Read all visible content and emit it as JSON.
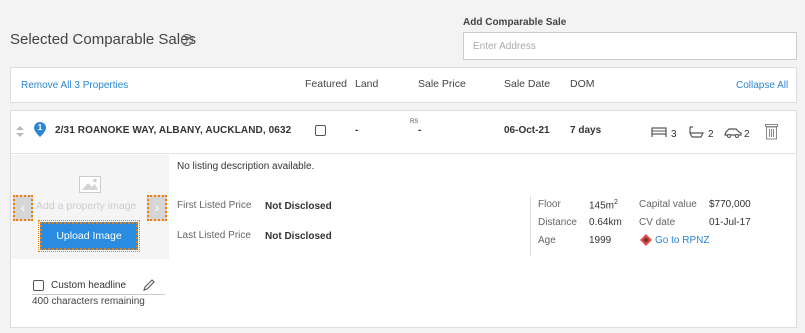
{
  "page": {
    "title": "Selected Comparable Sales",
    "help_icon": "?"
  },
  "add_sale": {
    "label": "Add Comparable Sale",
    "placeholder": "Enter Address"
  },
  "header": {
    "remove_all": "Remove All 3 Properties",
    "columns": {
      "featured": "Featured",
      "land": "Land",
      "sale_price": "Sale Price",
      "sale_date": "Sale Date",
      "dom": "DOM"
    },
    "collapse_all": "Collapse All"
  },
  "property": {
    "pin_number": "1",
    "address": "2/31 ROANOKE WAY, ALBANY, AUCKLAND, 0632",
    "land": "-",
    "sale_price_tag": "RS",
    "sale_price": "-",
    "sale_date": "06-Oct-21",
    "dom": "7 days",
    "bedrooms": "3",
    "bathrooms": "2",
    "car_parks": "2",
    "description": "No listing description available.",
    "add_image_text": "Add a property image",
    "upload_button": "Upload Image",
    "prev_arrow": "‹",
    "next_arrow": "›",
    "first_listed_label": "First Listed Price",
    "first_listed_value": "Not Disclosed",
    "last_listed_label": "Last Listed Price",
    "last_listed_value": "Not Disclosed",
    "floor_label": "Floor",
    "floor_value": "145m",
    "floor_unit_sup": "2",
    "distance_label": "Distance",
    "distance_value": "0.64km",
    "age_label": "Age",
    "age_value": "1999",
    "capital_value_label": "Capital value",
    "capital_value": "$770,000",
    "cv_date_label": "CV date",
    "cv_date": "01-Jul-17",
    "rpnz_link": "Go to RPNZ",
    "custom_headline_label": "Custom headline",
    "chars_remaining": "400 characters remaining"
  },
  "colors": {
    "accent": "#2a86d4",
    "button": "#2a8ce0",
    "highlight": "#f07c00",
    "rpnz": "#d9534f"
  }
}
